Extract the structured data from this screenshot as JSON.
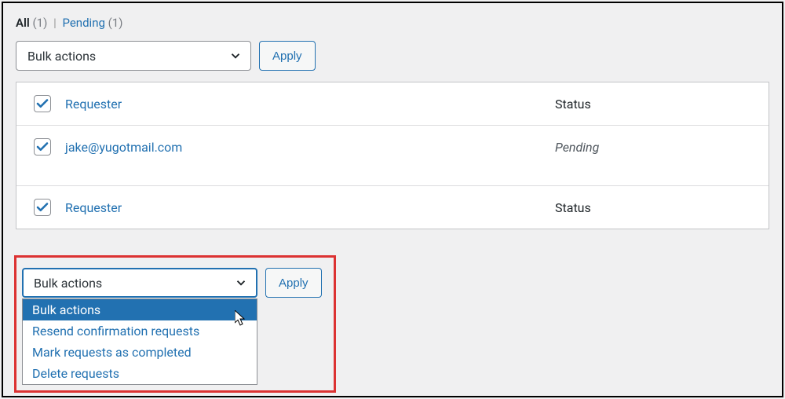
{
  "tabs": {
    "all_label": "All",
    "all_count": "(1)",
    "separator": "|",
    "pending_label": "Pending",
    "pending_count": "(1)"
  },
  "bulk_top": {
    "select_value": "Bulk actions",
    "apply_label": "Apply"
  },
  "table": {
    "header": {
      "requester_label": "Requester",
      "status_label": "Status"
    },
    "rows": [
      {
        "requester": "jake@yugotmail.com",
        "status": "Pending"
      }
    ],
    "footer": {
      "requester_label": "Requester",
      "status_label": "Status"
    }
  },
  "bulk_bottom": {
    "select_value": "Bulk actions",
    "apply_label": "Apply",
    "options": [
      "Bulk actions",
      "Resend confirmation requests",
      "Mark requests as completed",
      "Delete requests"
    ]
  }
}
